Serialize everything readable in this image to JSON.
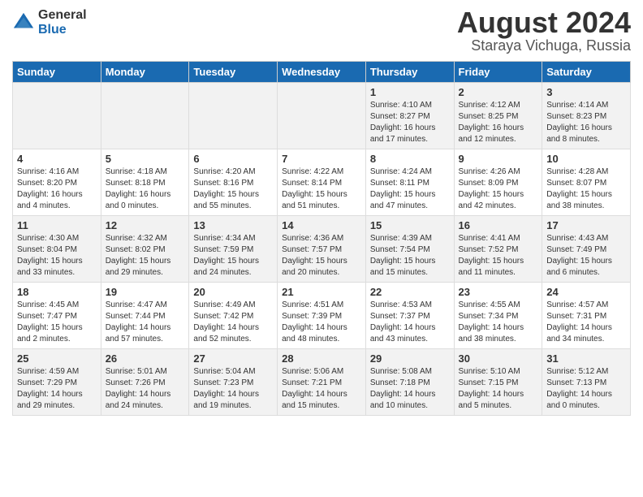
{
  "logo": {
    "general": "General",
    "blue": "Blue"
  },
  "title": "August 2024",
  "subtitle": "Staraya Vichuga, Russia",
  "days_of_week": [
    "Sunday",
    "Monday",
    "Tuesday",
    "Wednesday",
    "Thursday",
    "Friday",
    "Saturday"
  ],
  "weeks": [
    [
      {
        "day": "",
        "info": ""
      },
      {
        "day": "",
        "info": ""
      },
      {
        "day": "",
        "info": ""
      },
      {
        "day": "",
        "info": ""
      },
      {
        "day": "1",
        "info": "Sunrise: 4:10 AM\nSunset: 8:27 PM\nDaylight: 16 hours\nand 17 minutes."
      },
      {
        "day": "2",
        "info": "Sunrise: 4:12 AM\nSunset: 8:25 PM\nDaylight: 16 hours\nand 12 minutes."
      },
      {
        "day": "3",
        "info": "Sunrise: 4:14 AM\nSunset: 8:23 PM\nDaylight: 16 hours\nand 8 minutes."
      }
    ],
    [
      {
        "day": "4",
        "info": "Sunrise: 4:16 AM\nSunset: 8:20 PM\nDaylight: 16 hours\nand 4 minutes."
      },
      {
        "day": "5",
        "info": "Sunrise: 4:18 AM\nSunset: 8:18 PM\nDaylight: 16 hours\nand 0 minutes."
      },
      {
        "day": "6",
        "info": "Sunrise: 4:20 AM\nSunset: 8:16 PM\nDaylight: 15 hours\nand 55 minutes."
      },
      {
        "day": "7",
        "info": "Sunrise: 4:22 AM\nSunset: 8:14 PM\nDaylight: 15 hours\nand 51 minutes."
      },
      {
        "day": "8",
        "info": "Sunrise: 4:24 AM\nSunset: 8:11 PM\nDaylight: 15 hours\nand 47 minutes."
      },
      {
        "day": "9",
        "info": "Sunrise: 4:26 AM\nSunset: 8:09 PM\nDaylight: 15 hours\nand 42 minutes."
      },
      {
        "day": "10",
        "info": "Sunrise: 4:28 AM\nSunset: 8:07 PM\nDaylight: 15 hours\nand 38 minutes."
      }
    ],
    [
      {
        "day": "11",
        "info": "Sunrise: 4:30 AM\nSunset: 8:04 PM\nDaylight: 15 hours\nand 33 minutes."
      },
      {
        "day": "12",
        "info": "Sunrise: 4:32 AM\nSunset: 8:02 PM\nDaylight: 15 hours\nand 29 minutes."
      },
      {
        "day": "13",
        "info": "Sunrise: 4:34 AM\nSunset: 7:59 PM\nDaylight: 15 hours\nand 24 minutes."
      },
      {
        "day": "14",
        "info": "Sunrise: 4:36 AM\nSunset: 7:57 PM\nDaylight: 15 hours\nand 20 minutes."
      },
      {
        "day": "15",
        "info": "Sunrise: 4:39 AM\nSunset: 7:54 PM\nDaylight: 15 hours\nand 15 minutes."
      },
      {
        "day": "16",
        "info": "Sunrise: 4:41 AM\nSunset: 7:52 PM\nDaylight: 15 hours\nand 11 minutes."
      },
      {
        "day": "17",
        "info": "Sunrise: 4:43 AM\nSunset: 7:49 PM\nDaylight: 15 hours\nand 6 minutes."
      }
    ],
    [
      {
        "day": "18",
        "info": "Sunrise: 4:45 AM\nSunset: 7:47 PM\nDaylight: 15 hours\nand 2 minutes."
      },
      {
        "day": "19",
        "info": "Sunrise: 4:47 AM\nSunset: 7:44 PM\nDaylight: 14 hours\nand 57 minutes."
      },
      {
        "day": "20",
        "info": "Sunrise: 4:49 AM\nSunset: 7:42 PM\nDaylight: 14 hours\nand 52 minutes."
      },
      {
        "day": "21",
        "info": "Sunrise: 4:51 AM\nSunset: 7:39 PM\nDaylight: 14 hours\nand 48 minutes."
      },
      {
        "day": "22",
        "info": "Sunrise: 4:53 AM\nSunset: 7:37 PM\nDaylight: 14 hours\nand 43 minutes."
      },
      {
        "day": "23",
        "info": "Sunrise: 4:55 AM\nSunset: 7:34 PM\nDaylight: 14 hours\nand 38 minutes."
      },
      {
        "day": "24",
        "info": "Sunrise: 4:57 AM\nSunset: 7:31 PM\nDaylight: 14 hours\nand 34 minutes."
      }
    ],
    [
      {
        "day": "25",
        "info": "Sunrise: 4:59 AM\nSunset: 7:29 PM\nDaylight: 14 hours\nand 29 minutes."
      },
      {
        "day": "26",
        "info": "Sunrise: 5:01 AM\nSunset: 7:26 PM\nDaylight: 14 hours\nand 24 minutes."
      },
      {
        "day": "27",
        "info": "Sunrise: 5:04 AM\nSunset: 7:23 PM\nDaylight: 14 hours\nand 19 minutes."
      },
      {
        "day": "28",
        "info": "Sunrise: 5:06 AM\nSunset: 7:21 PM\nDaylight: 14 hours\nand 15 minutes."
      },
      {
        "day": "29",
        "info": "Sunrise: 5:08 AM\nSunset: 7:18 PM\nDaylight: 14 hours\nand 10 minutes."
      },
      {
        "day": "30",
        "info": "Sunrise: 5:10 AM\nSunset: 7:15 PM\nDaylight: 14 hours\nand 5 minutes."
      },
      {
        "day": "31",
        "info": "Sunrise: 5:12 AM\nSunset: 7:13 PM\nDaylight: 14 hours\nand 0 minutes."
      }
    ]
  ]
}
